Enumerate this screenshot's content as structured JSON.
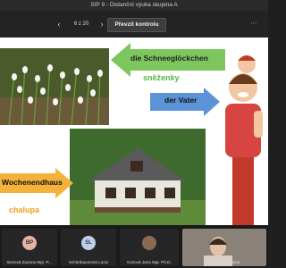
{
  "window": {
    "title": "SIP 9 - Distanční výuka skupina A"
  },
  "toolbar": {
    "page_counter": "6 z 20",
    "takeover_label": "Převzít kontrolu"
  },
  "slide": {
    "labels": {
      "snowdrop_de": "die Schneeglöckchen",
      "snowdrop_cs": "sněženky",
      "father_de": "der Vater",
      "cottage_de": "Wochenendhaus",
      "cottage_cs": "chalupa"
    },
    "colors": {
      "arrow": "#5b93d6",
      "arrow_green": "#7cc65d",
      "arrow_orange": "#f5b23a",
      "text_green": "#58b545",
      "text_orange": "#f0a020"
    }
  },
  "participants": [
    {
      "initials": "BP",
      "name": "Bezová Zuzana Mgr. P..."
    },
    {
      "initials": "SL",
      "name": "Schönbaumová Lucie"
    },
    {
      "initials": "",
      "name": "Kozová Jana Mgr. Ph.D."
    },
    {
      "initials": "",
      "name": "Tučková Kristýna"
    }
  ]
}
